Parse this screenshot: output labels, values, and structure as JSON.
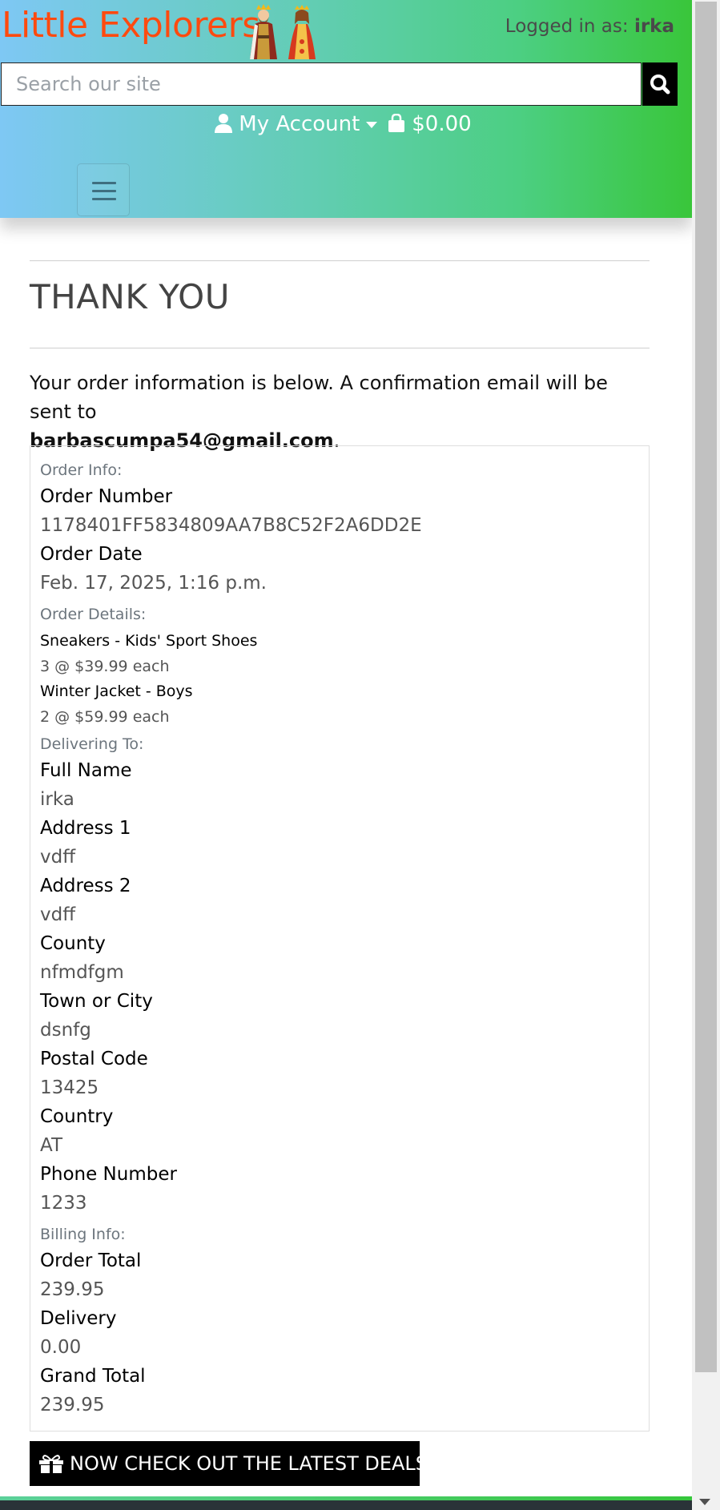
{
  "header": {
    "logo_text": "Little Explorers",
    "logged_in_prefix": "Logged in as:",
    "username": "irka",
    "search_placeholder": "Search our site",
    "account_label": "My Account",
    "cart_total": "$0.00"
  },
  "main": {
    "title": "THANK YOU",
    "intro_text": "Your order information is below. A confirmation email will be sent to",
    "email": "barbascumpa54@gmail.com",
    "intro_end": "."
  },
  "order": {
    "order_info_heading": "Order Info:",
    "order_number_label": "Order Number",
    "order_number": "1178401FF5834809AA7B8C52F2A6DD2E",
    "order_date_label": "Order Date",
    "order_date": "Feb. 17, 2025, 1:16 p.m.",
    "order_details_heading": "Order Details:",
    "items": [
      {
        "name": "Sneakers - Kids' Sport Shoes",
        "qty_price": "3 @ $39.99 each"
      },
      {
        "name": "Winter Jacket - Boys",
        "qty_price": "2 @ $59.99 each"
      }
    ],
    "delivering_heading": "Delivering To:",
    "full_name_label": "Full Name",
    "full_name": "irka",
    "address1_label": "Address 1",
    "address1": "vdff",
    "address2_label": "Address 2",
    "address2": "vdff",
    "county_label": "County",
    "county": "nfmdfgm",
    "town_label": "Town or City",
    "town": "dsnfg",
    "postal_label": "Postal Code",
    "postal": "13425",
    "country_label": "Country",
    "country": "AT",
    "phone_label": "Phone Number",
    "phone": "1233",
    "billing_heading": "Billing Info:",
    "order_total_label": "Order Total",
    "order_total": "239.95",
    "delivery_label": "Delivery",
    "delivery": "0.00",
    "grand_total_label": "Grand Total",
    "grand_total": "239.95"
  },
  "cta": {
    "deals_label": "NOW CHECK OUT THE LATEST DEALS!"
  },
  "colors": {
    "logo": "#ff4a0f",
    "header_start": "#7ec8f4",
    "header_end": "#39c63a",
    "button_bg": "#000000"
  },
  "icons": [
    "user-icon",
    "shopping-bag-icon",
    "search-icon",
    "hamburger-icon",
    "gift-icon",
    "king-queen-logo-icon"
  ]
}
